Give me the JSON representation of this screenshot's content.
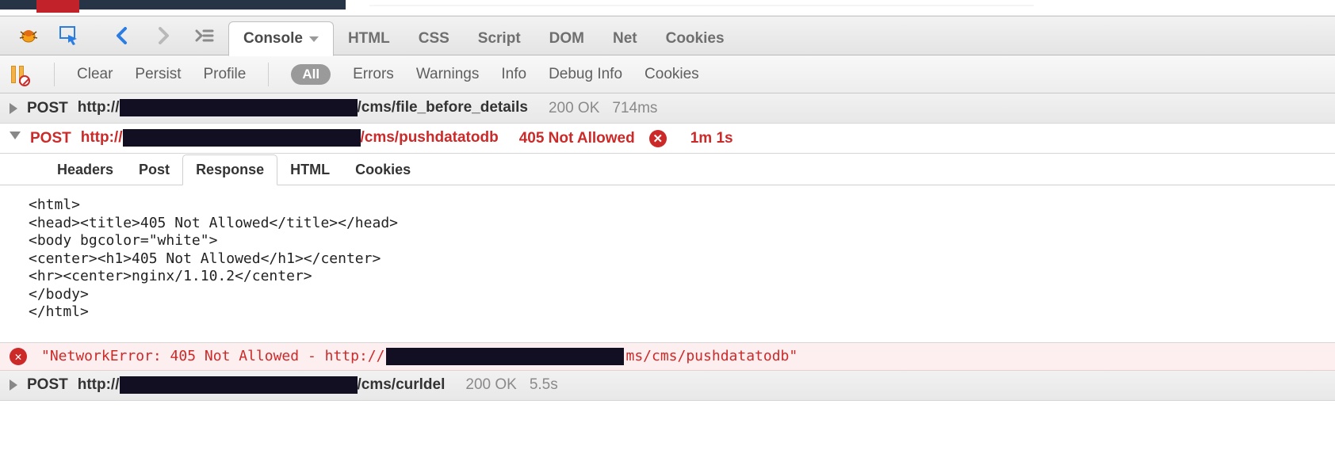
{
  "top_tabs": {
    "console": "Console",
    "html": "HTML",
    "css": "CSS",
    "script": "Script",
    "dom": "DOM",
    "net": "Net",
    "cookies": "Cookies"
  },
  "sub_toolbar": {
    "clear": "Clear",
    "persist": "Persist",
    "profile": "Profile",
    "all": "All",
    "errors": "Errors",
    "warnings": "Warnings",
    "info": "Info",
    "debug_info": "Debug Info",
    "cookies": "Cookies"
  },
  "requests": [
    {
      "method": "POST",
      "url_prefix": "http://",
      "url_suffix": "/cms/file_before_details",
      "status": "200 OK",
      "timing": "714ms",
      "error": false,
      "expanded": false
    },
    {
      "method": "POST",
      "url_prefix": "http://",
      "url_suffix": "/cms/pushdatatodb",
      "status": "405 Not Allowed",
      "timing": "1m 1s",
      "error": true,
      "expanded": true
    },
    {
      "method": "POST",
      "url_prefix": "http://",
      "url_suffix": "/cms/curldel",
      "status": "200 OK",
      "timing": "5.5s",
      "error": false,
      "expanded": false
    }
  ],
  "detail_tabs": {
    "headers": "Headers",
    "post": "Post",
    "response": "Response",
    "html": "HTML",
    "cookies": "Cookies"
  },
  "response_body": "<html>\n<head><title>405 Not Allowed</title></head>\n<body bgcolor=\"white\">\n<center><h1>405 Not Allowed</h1></center>\n<hr><center>nginx/1.10.2</center>\n</body>\n</html>",
  "network_error": {
    "prefix": "\"NetworkError: 405 Not Allowed - http://",
    "suffix": "ms/cms/pushdatatodb\""
  }
}
